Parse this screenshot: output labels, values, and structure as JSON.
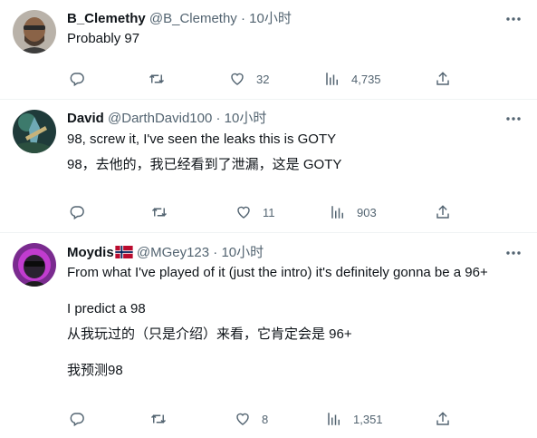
{
  "tweets": [
    {
      "name": "B_Clemethy",
      "handle": "@B_Clemethy",
      "separator": "·",
      "time": "10小时",
      "lines": [
        "Probably 97"
      ],
      "replies": "",
      "retweets": "",
      "likes": "32",
      "views": "4,735"
    },
    {
      "name": "David",
      "handle": "@DarthDavid100",
      "separator": "·",
      "time": "10小时",
      "lines": [
        "98, screw it, I've seen the leaks this is GOTY",
        "98，去他的，我已经看到了泄漏，这是 GOTY"
      ],
      "replies": "",
      "retweets": "",
      "likes": "11",
      "views": "903"
    },
    {
      "name": "Moydis",
      "handle": "@MGey123",
      "separator": "·",
      "time": "10小时",
      "lines": [
        "From what I've played of it (just the intro) it's definitely gonna be a 96+",
        "I predict a 98",
        "从我玩过的（只是介绍）来看，它肯定会是 96+",
        "我预测98"
      ],
      "replies": "",
      "retweets": "",
      "likes": "8",
      "views": "1,351"
    }
  ],
  "colors": {
    "text": "#0f1419",
    "secondary": "#536471",
    "divider": "#eff3f4",
    "flag_red": "#ba0c2f",
    "flag_blue": "#00205b"
  },
  "icons": [
    "reply-icon",
    "retweet-icon",
    "like-icon",
    "views-icon",
    "share-icon",
    "more-icon",
    "norway-flag-icon"
  ]
}
